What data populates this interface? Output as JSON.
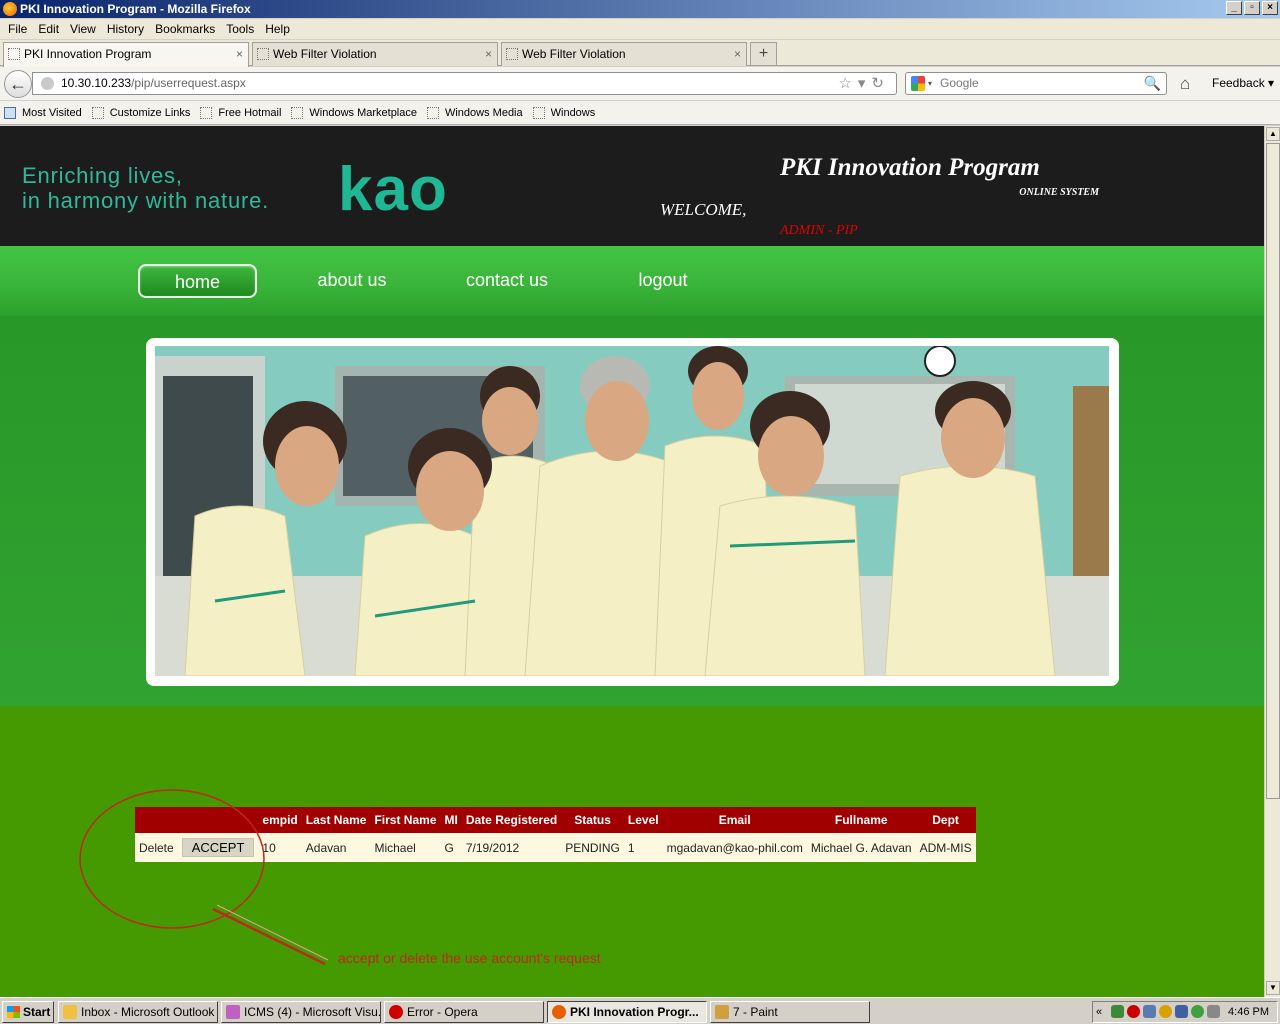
{
  "window": {
    "title": "PKI Innovation Program - Mozilla Firefox"
  },
  "menu": [
    "File",
    "Edit",
    "View",
    "History",
    "Bookmarks",
    "Tools",
    "Help"
  ],
  "tabs": [
    {
      "label": "PKI Innovation Program"
    },
    {
      "label": "Web Filter Violation"
    },
    {
      "label": "Web Filter Violation"
    }
  ],
  "nav": {
    "url_host": "10.30.10.233",
    "url_path": "/pip/userrequest.aspx",
    "search_placeholder": "Google",
    "feedback": "Feedback"
  },
  "bookmarks": [
    "Most Visited",
    "Customize Links",
    "Free Hotmail",
    "Windows Marketplace",
    "Windows Media",
    "Windows"
  ],
  "page": {
    "tagline_line1": "Enriching lives,",
    "tagline_line2": "in harmony with nature.",
    "logo": "kao",
    "program_title": "PKI Innovation Program",
    "program_subtitle": "ONLINE SYSTEM",
    "welcome": "WELCOME,",
    "username": "ADMIN - PIP",
    "menu": [
      "home",
      "about us",
      "contact us",
      "logout"
    ],
    "table": {
      "headers": [
        "",
        "",
        "empid",
        "Last Name",
        "First Name",
        "MI",
        "Date Registered",
        "Status",
        "Level",
        "Email",
        "Fullname",
        "Dept"
      ],
      "row": {
        "delete": "Delete",
        "accept": "ACCEPT",
        "empid": "10",
        "last_name": "Adavan",
        "first_name": "Michael",
        "mi": "G",
        "date_registered": "7/19/2012",
        "status": "PENDING",
        "level": "1",
        "email": "mgadavan@kao-phil.com",
        "fullname": "Michael G. Adavan",
        "dept": "ADM-MIS"
      }
    },
    "annotation": "accept or delete the use account's request"
  },
  "taskbar": {
    "start": "Start",
    "tasks": [
      "Inbox - Microsoft Outlook",
      "ICMS (4) - Microsoft Visu...",
      "Error - Opera",
      "PKI Innovation Progr...",
      "7 - Paint"
    ],
    "clock": "4:46 PM"
  },
  "colors": {
    "page_bg": "#449a00",
    "header_bg": "#1c1c1c",
    "table_header": "#a00000",
    "annotation": "#c0281c"
  }
}
